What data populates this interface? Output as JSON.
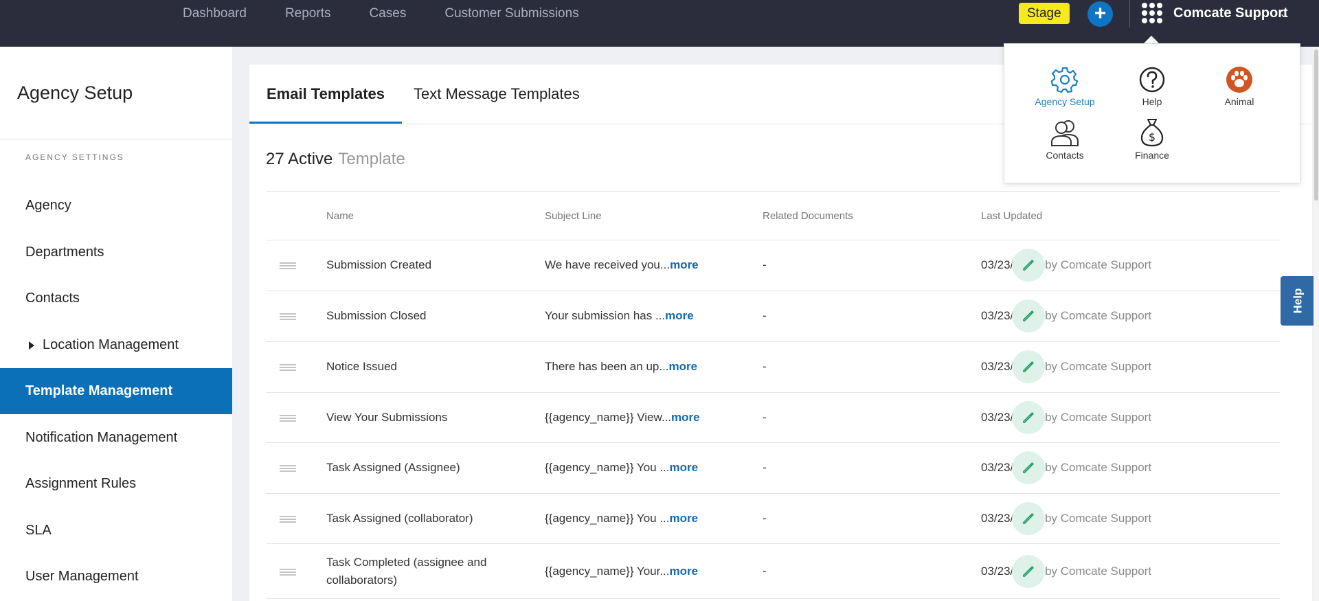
{
  "topnav": {
    "items": [
      "Dashboard",
      "Reports",
      "Cases",
      "Customer Submissions"
    ],
    "stage_label": "Stage",
    "plus_label": "+",
    "account_name": "Comcate Support",
    "icons": [
      "plus-icon",
      "apps-grid-icon",
      "chevron-down-icon"
    ],
    "colors": {
      "bar": "#2b2d3c",
      "stage": "#f5ea1b",
      "plus": "#0e74c4"
    }
  },
  "apps_menu": {
    "items": [
      {
        "label": "Agency Setup",
        "icon": "gear-icon",
        "active": true
      },
      {
        "label": "Help",
        "icon": "question-circle-icon",
        "active": false
      },
      {
        "label": "Animal",
        "icon": "paw-icon",
        "active": false
      },
      {
        "label": "Contacts",
        "icon": "people-icon",
        "active": false
      },
      {
        "label": "Finance",
        "icon": "money-bag-icon",
        "active": false
      }
    ]
  },
  "sidebar": {
    "title": "Agency Setup",
    "section_label": "AGENCY SETTINGS",
    "items": [
      {
        "label": "Agency",
        "active": false
      },
      {
        "label": "Departments",
        "active": false
      },
      {
        "label": "Contacts",
        "active": false
      },
      {
        "label": "Location Management",
        "active": false,
        "expandable": true
      },
      {
        "label": "Template Management",
        "active": true
      },
      {
        "label": "Notification Management",
        "active": false
      },
      {
        "label": "Assignment Rules",
        "active": false
      },
      {
        "label": "SLA",
        "active": false
      },
      {
        "label": "User Management",
        "active": false
      }
    ],
    "active_color": "#0c70b8"
  },
  "main": {
    "tabs": [
      {
        "label": "Email Templates",
        "active": true
      },
      {
        "label": "Text Message Templates",
        "active": false
      }
    ],
    "count_number": "27 Active",
    "count_word": "Template",
    "columns": [
      "Name",
      "Subject Line",
      "Related Documents",
      "Last Updated"
    ],
    "more_label": "more",
    "rows": [
      {
        "name": "Submission Created",
        "subject": "We have received you...",
        "docs": "-",
        "date": "03/23/2023",
        "by": "by Comcate Support"
      },
      {
        "name": "Submission Closed",
        "subject": "Your submission has ...",
        "docs": "-",
        "date": "03/23/2023",
        "by": "by Comcate Support"
      },
      {
        "name": "Notice Issued",
        "subject": "There has been an up...",
        "docs": "-",
        "date": "03/23/2023",
        "by": "by Comcate Support"
      },
      {
        "name": "View Your Submissions",
        "subject": "{{agency_name}} View...",
        "docs": "-",
        "date": "03/23/2023",
        "by": "by Comcate Support"
      },
      {
        "name": "Task Assigned (Assignee)",
        "subject": "{{agency_name}} You ...",
        "docs": "-",
        "date": "03/23/2023",
        "by": "by Comcate Support"
      },
      {
        "name": "Task Assigned (collaborator)",
        "subject": "{{agency_name}} You ...",
        "docs": "-",
        "date": "03/23/2023",
        "by": "by Comcate Support"
      },
      {
        "name": "Task Completed (assignee and collaborators)",
        "subject": "{{agency_name}} Your...",
        "docs": "-",
        "date": "03/23/2023",
        "by": "by Comcate Support"
      }
    ],
    "edit_icon": "pencil-icon",
    "drag_icon": "drag-handle-icon"
  },
  "help_tab": {
    "label": "Help"
  }
}
